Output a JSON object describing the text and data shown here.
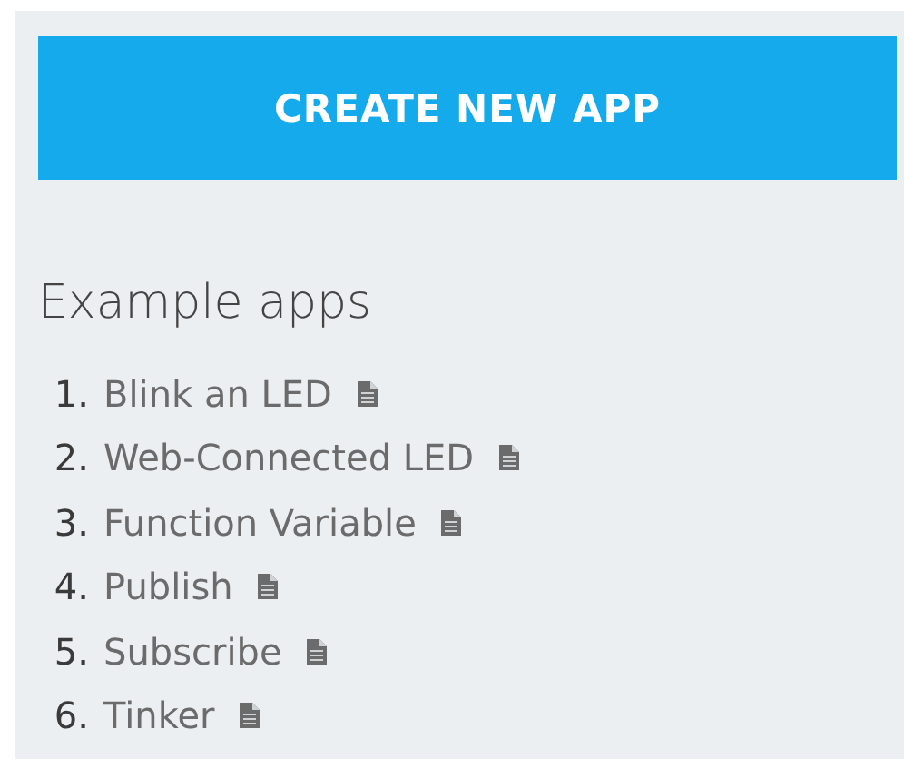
{
  "create_button": {
    "label": "CREATE NEW APP"
  },
  "examples": {
    "title": "Example apps",
    "items": [
      {
        "number": "1.",
        "label": "Blink an LED"
      },
      {
        "number": "2.",
        "label": "Web-Connected LED"
      },
      {
        "number": "3.",
        "label": "Function Variable"
      },
      {
        "number": "4.",
        "label": "Publish"
      },
      {
        "number": "5.",
        "label": "Subscribe"
      },
      {
        "number": "6.",
        "label": "Tinker"
      }
    ]
  }
}
